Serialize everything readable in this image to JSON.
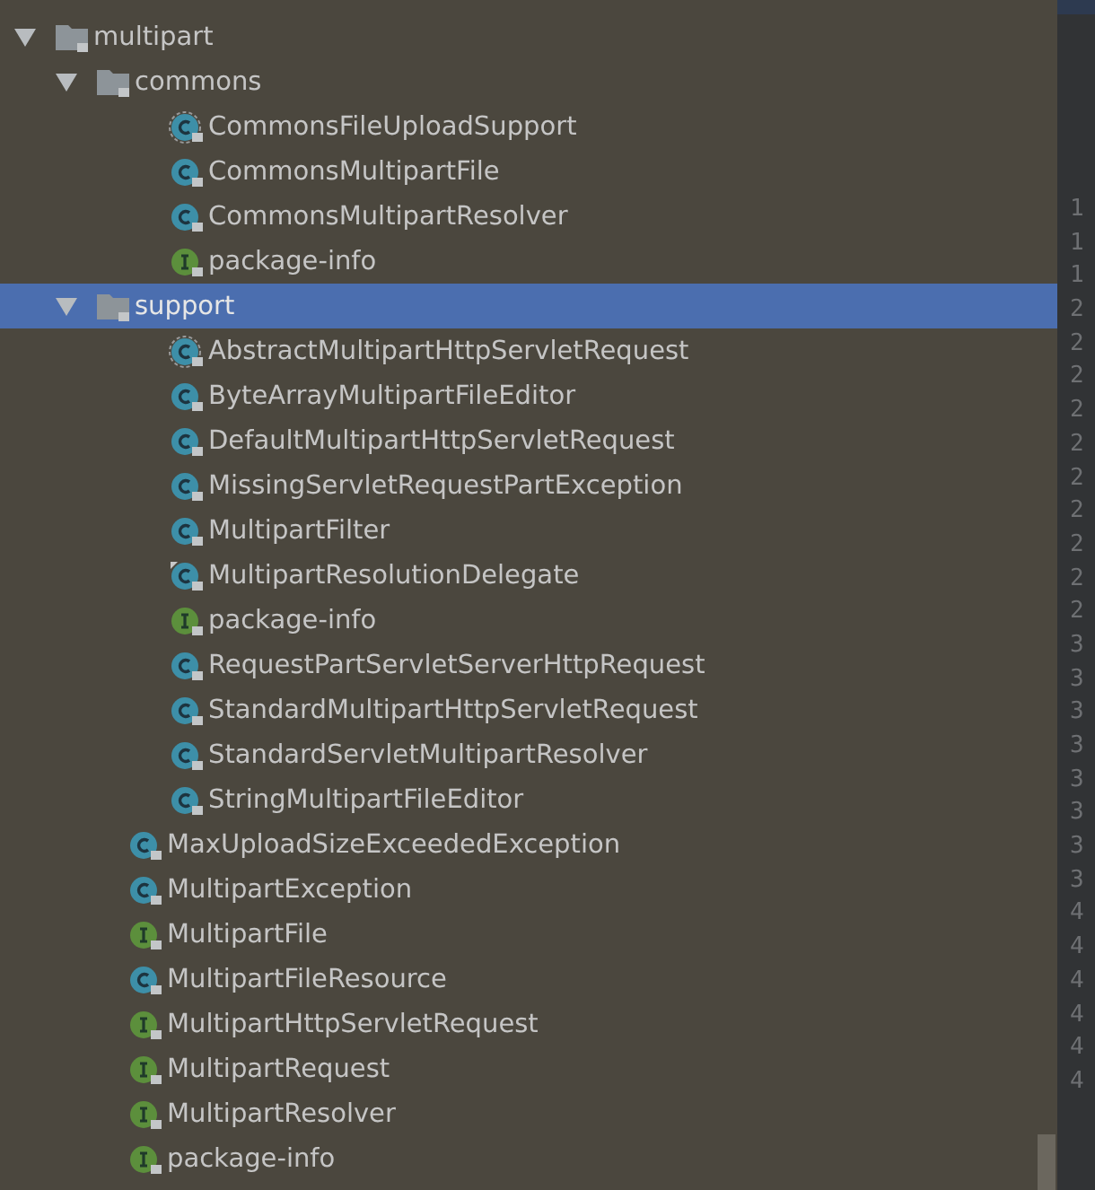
{
  "tree": [
    {
      "label": "multipart",
      "kind": "folder",
      "expanded": true,
      "selected": false,
      "children": [
        {
          "label": "commons",
          "kind": "folder",
          "expanded": true,
          "selected": false,
          "children": [
            {
              "label": "CommonsFileUploadSupport",
              "kind": "abstract_class",
              "selected": false
            },
            {
              "label": "CommonsMultipartFile",
              "kind": "class",
              "selected": false
            },
            {
              "label": "CommonsMultipartResolver",
              "kind": "class",
              "selected": false
            },
            {
              "label": "package-info",
              "kind": "interface",
              "selected": false
            }
          ]
        },
        {
          "label": "support",
          "kind": "folder",
          "expanded": true,
          "selected": true,
          "children": [
            {
              "label": "AbstractMultipartHttpServletRequest",
              "kind": "abstract_class",
              "selected": false
            },
            {
              "label": "ByteArrayMultipartFileEditor",
              "kind": "class",
              "selected": false
            },
            {
              "label": "DefaultMultipartHttpServletRequest",
              "kind": "class",
              "selected": false
            },
            {
              "label": "MissingServletRequestPartException",
              "kind": "class",
              "selected": false
            },
            {
              "label": "MultipartFilter",
              "kind": "class",
              "selected": false
            },
            {
              "label": "MultipartResolutionDelegate",
              "kind": "marked_class",
              "selected": false
            },
            {
              "label": "package-info",
              "kind": "interface",
              "selected": false
            },
            {
              "label": "RequestPartServletServerHttpRequest",
              "kind": "class",
              "selected": false
            },
            {
              "label": "StandardMultipartHttpServletRequest",
              "kind": "class",
              "selected": false
            },
            {
              "label": "StandardServletMultipartResolver",
              "kind": "class",
              "selected": false
            },
            {
              "label": "StringMultipartFileEditor",
              "kind": "class",
              "selected": false
            }
          ]
        },
        {
          "label": "MaxUploadSizeExceededException",
          "kind": "class",
          "selected": false
        },
        {
          "label": "MultipartException",
          "kind": "class",
          "selected": false
        },
        {
          "label": "MultipartFile",
          "kind": "interface",
          "selected": false
        },
        {
          "label": "MultipartFileResource",
          "kind": "class",
          "selected": false
        },
        {
          "label": "MultipartHttpServletRequest",
          "kind": "interface",
          "selected": false
        },
        {
          "label": "MultipartRequest",
          "kind": "interface",
          "selected": false
        },
        {
          "label": "MultipartResolver",
          "kind": "interface",
          "selected": false
        },
        {
          "label": "package-info",
          "kind": "interface",
          "selected": false
        }
      ]
    }
  ],
  "gutter": {
    "line_numbers": [
      "1",
      "1",
      "1",
      "2",
      "2",
      "2",
      "2",
      "2",
      "2",
      "2",
      "2",
      "2",
      "2",
      "3",
      "3",
      "3",
      "3",
      "3",
      "3",
      "3",
      "3",
      "4",
      "4",
      "4",
      "4",
      "4",
      "4"
    ]
  }
}
